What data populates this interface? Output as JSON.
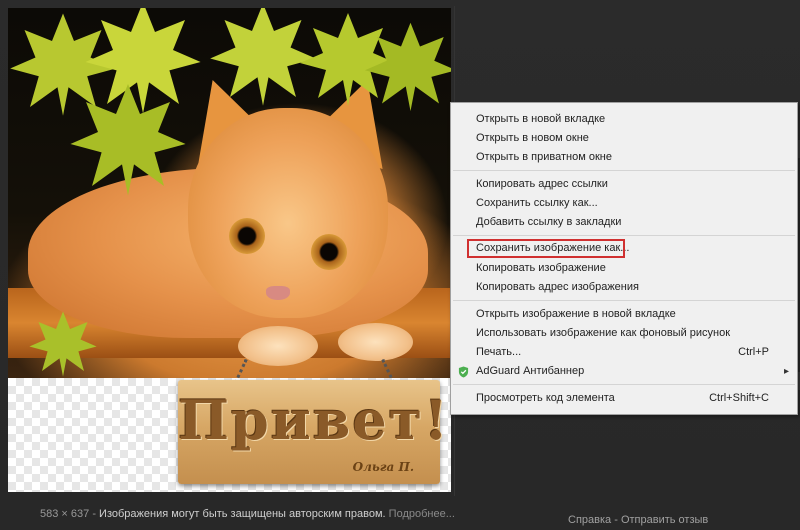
{
  "image": {
    "sign_text": "Привет!",
    "sign_signature": "Ольга П."
  },
  "context_menu": {
    "items": [
      {
        "label": "Открыть в новой вкладке",
        "shortcut": ""
      },
      {
        "label": "Открыть в новом окне",
        "shortcut": ""
      },
      {
        "label": "Открыть в приватном окне",
        "shortcut": ""
      },
      {
        "label": "Копировать адрес ссылки",
        "shortcut": ""
      },
      {
        "label": "Сохранить ссылку как...",
        "shortcut": ""
      },
      {
        "label": "Добавить ссылку в закладки",
        "shortcut": ""
      },
      {
        "label": "Сохранить изображение как...",
        "shortcut": "",
        "highlighted": true
      },
      {
        "label": "Копировать изображение",
        "shortcut": ""
      },
      {
        "label": "Копировать адрес изображения",
        "shortcut": ""
      },
      {
        "label": "Открыть изображение в новой вкладке",
        "shortcut": ""
      },
      {
        "label": "Использовать изображение как фоновый рисунок",
        "shortcut": ""
      },
      {
        "label": "Печать...",
        "shortcut": "Ctrl+P"
      },
      {
        "label": "AdGuard Антибаннер",
        "shortcut": "",
        "icon": "shield-check-icon",
        "submenu": true
      },
      {
        "label": "Просмотреть код элемента",
        "shortcut": "Ctrl+Shift+C"
      }
    ],
    "highlight_color": "#d03030",
    "adguard_color": "#4caf50"
  },
  "footer": {
    "dimensions": "583 × 637",
    "separator": "-",
    "copyright_warning": "Изображения могут быть защищены авторским правом.",
    "more_link": "Подробнее...",
    "help_link": "Справка",
    "feedback_separator": "-",
    "feedback_link": "Отправить отзыв"
  }
}
